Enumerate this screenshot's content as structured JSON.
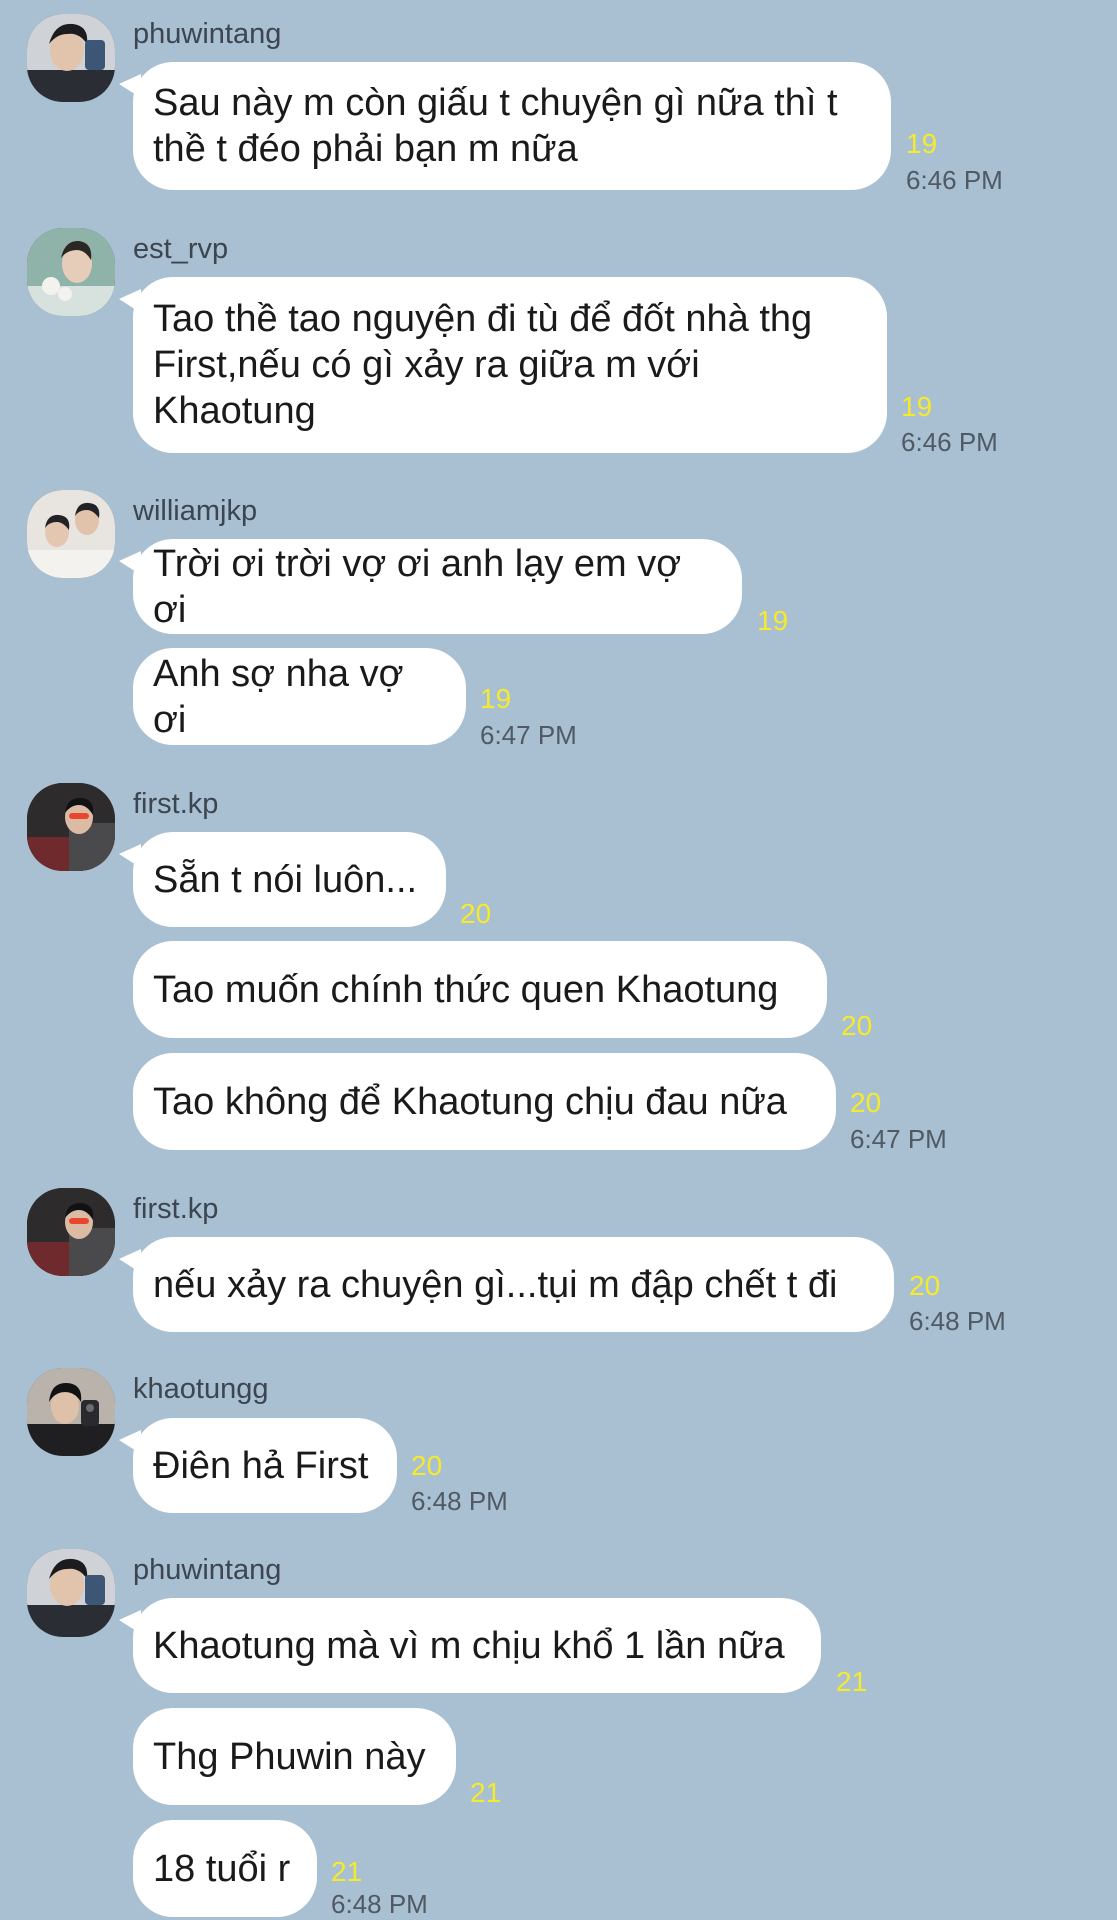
{
  "colors": {
    "background": "#a9bfd2",
    "bubble": "#ffffff",
    "read_count": "#f6ea2c",
    "username": "#3c4650",
    "time": "#4f5a64"
  },
  "messages": [
    {
      "user": "phuwintang",
      "text": "Sau này m còn giấu t chuyện gì nữa thì t\nthề t đéo phải bạn m nữa",
      "read": "19",
      "time": "6:46 PM"
    },
    {
      "user": "est_rvp",
      "text": "Tao thề tao nguyện đi tù để đốt nhà thg\nFirst,nếu có gì xảy ra giữa m với\nKhaotung",
      "read": "19",
      "time": "6:46 PM"
    },
    {
      "user": "williamjkp",
      "text": "Trời ơi trời vợ ơi anh lạy em vợ ơi",
      "read": "19"
    },
    {
      "text": "Anh sợ nha vợ ơi",
      "read": "19",
      "time": "6:47 PM"
    },
    {
      "user": "first.kp",
      "text": "Sẵn t nói luôn...",
      "read": "20"
    },
    {
      "text": "Tao muốn chính thức quen Khaotung",
      "read": "20"
    },
    {
      "text": "Tao không để Khaotung chịu đau nữa",
      "read": "20",
      "time": "6:47 PM"
    },
    {
      "user": "first.kp",
      "text": "nếu xảy ra chuyện gì...tụi m đập chết t đi",
      "read": "20",
      "time": "6:48 PM"
    },
    {
      "user": "khaotungg",
      "text": "Điên hả First",
      "read": "20",
      "time": "6:48 PM"
    },
    {
      "user": "phuwintang",
      "text": "Khaotung mà vì m chịu khổ 1 lần nữa",
      "read": "21"
    },
    {
      "text": "Thg Phuwin này",
      "read": "21"
    },
    {
      "text": "18 tuổi r",
      "read": "21",
      "time": "6:48 PM"
    }
  ]
}
